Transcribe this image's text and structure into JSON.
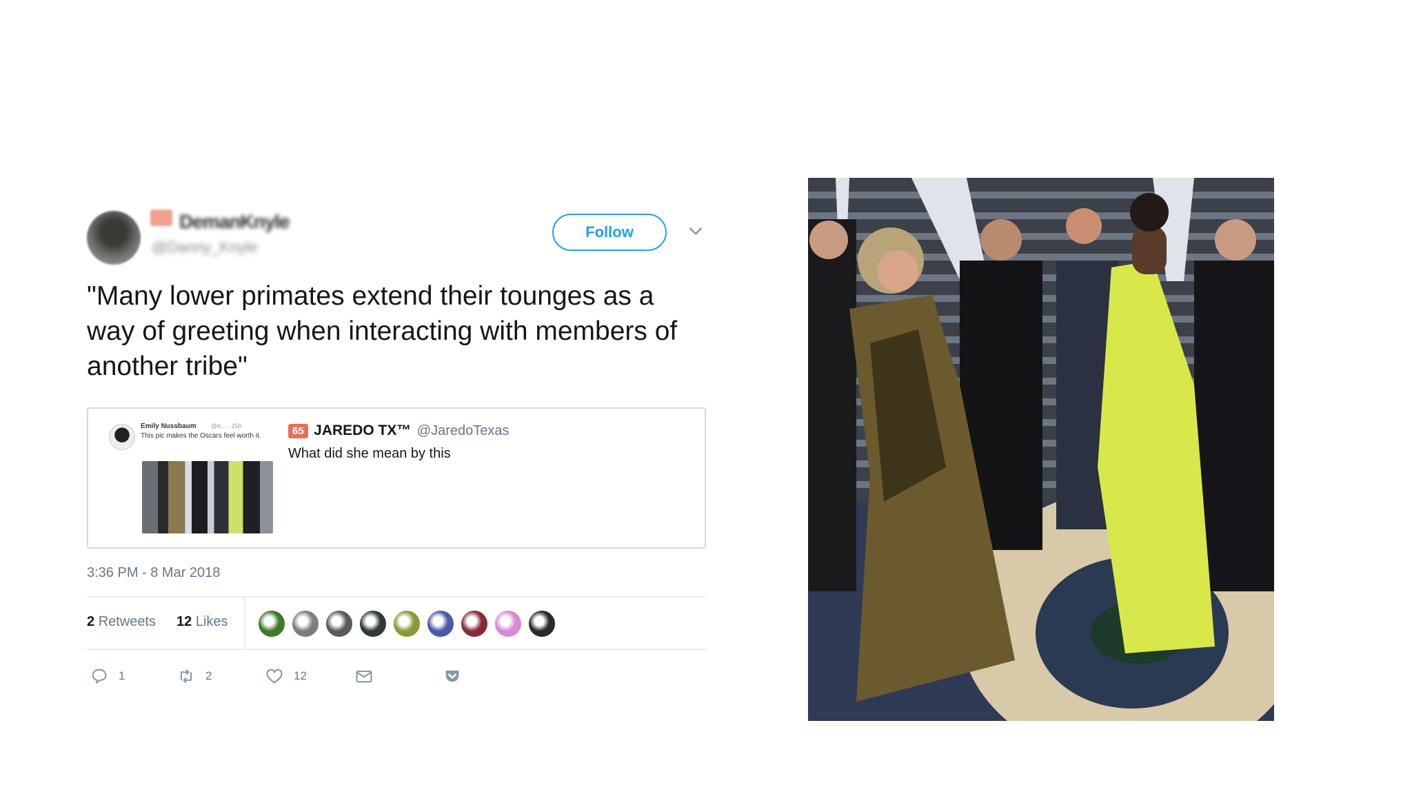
{
  "tweet": {
    "author_name": "DemanKnyle",
    "author_handle": "@Danny_Knyle",
    "follow_label": "Follow",
    "text": "\"Many lower primates extend their tounges as a way of greeting when interacting with members of another tribe\"",
    "timestamp": "3:36 PM - 8 Mar 2018",
    "quoted": {
      "badge": "65",
      "name": "JAREDO TX™",
      "handle": "@JaredoTexas",
      "text": "What did she mean by this",
      "embedded": {
        "name": "Emily Nussbaum",
        "meta": "@e... · 15h",
        "text": "This pic makes the Oscars feel worth it."
      }
    },
    "stats": {
      "retweets_count": "2",
      "retweets_label": "Retweets",
      "likes_count": "12",
      "likes_label": "Likes",
      "liker_avatar_colors": [
        "#3f7a2a",
        "#7d7f7a",
        "#5a5a5a",
        "#2e3b3a",
        "#8a9a3a",
        "#4a5aa8",
        "#8a2a3a",
        "#d78bd0",
        "#2a2a2a"
      ]
    },
    "actions": {
      "reply_count": "1",
      "retweet_count": "2",
      "like_count": "12"
    }
  },
  "colors": {
    "accent": "#1da1f2",
    "muted": "#657786",
    "border": "#e6ecf0"
  }
}
